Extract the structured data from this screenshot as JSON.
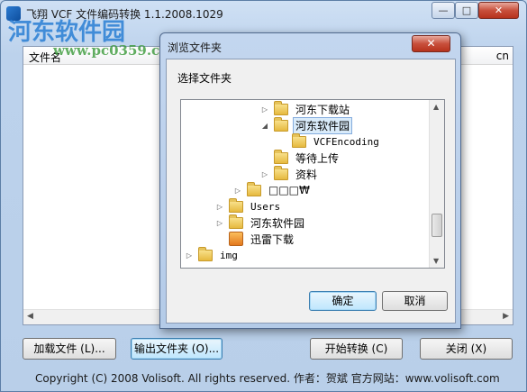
{
  "window": {
    "title": "飞翔 VCF 文件编码转换  1.1.2008.1029",
    "min_glyph": "—",
    "max_glyph": "□",
    "close_glyph": "✕"
  },
  "watermark": {
    "logo": "河东软件园",
    "url": "www.pc0359.cn"
  },
  "file_list": {
    "header_name": "文件名",
    "header_right": "cn"
  },
  "buttons": {
    "load": "加载文件 (L)...",
    "output": "输出文件夹 (O)...",
    "start": "开始转换 (C)",
    "close": "关闭 (X)"
  },
  "footer": "Copyright (C) 2008 Volisoft. All rights reserved.  作者：贺斌  官方网站：www.volisoft.com",
  "dialog": {
    "title": "浏览文件夹",
    "close_glyph": "✕",
    "prompt": "选择文件夹",
    "ok": "确定",
    "cancel": "取消",
    "tree": [
      {
        "label": "河东下载站",
        "arrow": "▷",
        "icon": "folder",
        "selected": false
      },
      {
        "label": "河东软件园",
        "arrow": "◢",
        "icon": "folder",
        "selected": true
      },
      {
        "label": "VCFEncoding",
        "arrow": "",
        "icon": "folder",
        "selected": false
      },
      {
        "label": "等待上传",
        "arrow": "",
        "icon": "folder",
        "selected": false
      },
      {
        "label": "资料",
        "arrow": "▷",
        "icon": "folder",
        "selected": false
      },
      {
        "label": "□□□₩",
        "arrow": "▷",
        "icon": "folder",
        "selected": false
      },
      {
        "label": "Users",
        "arrow": "▷",
        "icon": "folder",
        "selected": false
      },
      {
        "label": "河东软件园",
        "arrow": "▷",
        "icon": "folder",
        "selected": false
      },
      {
        "label": "迅雷下载",
        "arrow": "",
        "icon": "special",
        "selected": false
      },
      {
        "label": "img",
        "arrow": "▷",
        "icon": "folder",
        "selected": false
      }
    ]
  },
  "icons": {
    "app": "app-icon",
    "folder": "folder-icon",
    "thunder": "thunder-download-icon"
  }
}
